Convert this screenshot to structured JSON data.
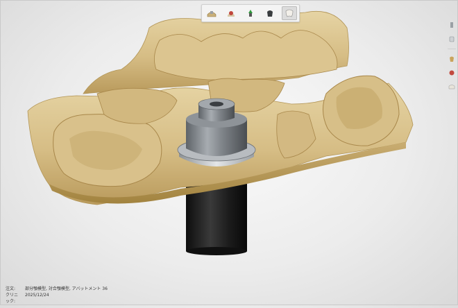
{
  "toolbar": {
    "items": [
      {
        "name": "model-view-1",
        "icon": "tooth-model-icon"
      },
      {
        "name": "model-view-2",
        "icon": "crown-red-icon"
      },
      {
        "name": "model-view-3",
        "icon": "gum-green-icon"
      },
      {
        "name": "model-view-4",
        "icon": "implant-dark-icon"
      },
      {
        "name": "model-view-5",
        "icon": "tooth-white-icon"
      }
    ],
    "active_index": 4
  },
  "side_tools": [
    "scanbody-icon",
    "cylinder-icon",
    "tooth-color-icon",
    "crown-red-icon",
    "teeth-icon"
  ],
  "footer": {
    "order_label": "注文:",
    "order_value": "部分顎模型, 対合顎模型, アバットメント 36",
    "clinic_label": "クリニック:",
    "clinic_value": "2025/12/24"
  },
  "colors": {
    "model_gypsum": "#d8c08a",
    "model_shadow": "#a9894f",
    "abutment_metal": "#8a8f95",
    "implant_analog": "#1c1c1c",
    "background": "#ececec"
  }
}
